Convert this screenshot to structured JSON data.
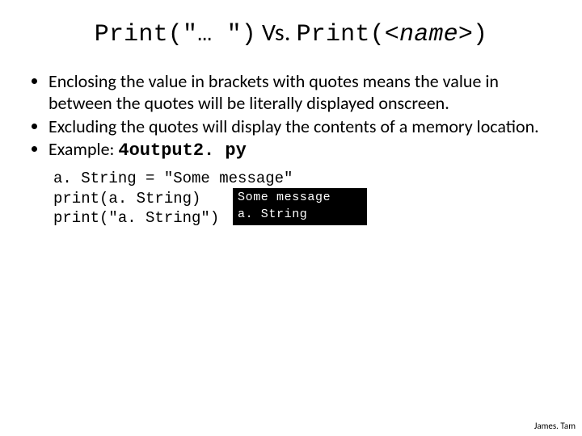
{
  "title": {
    "mono_left": "Print(\"… \")",
    "vs": " Vs. ",
    "mono_mid": "Print(<",
    "name": "name",
    "mono_right": ">)"
  },
  "bullets": {
    "b1": "Enclosing the value in brackets with quotes means the value in between the quotes will be literally displayed onscreen.",
    "b2": "Excluding the quotes will display the contents of a memory location.",
    "b3_prefix": "Example: ",
    "b3_file": "4output2. py"
  },
  "code": {
    "line1": "a. String = \"Some message\"",
    "line2": "print(a. String)",
    "line3": "print(\"a. String\")"
  },
  "terminal": {
    "line1": "Some message",
    "line2": "a. String"
  },
  "footer": "James. Tam"
}
